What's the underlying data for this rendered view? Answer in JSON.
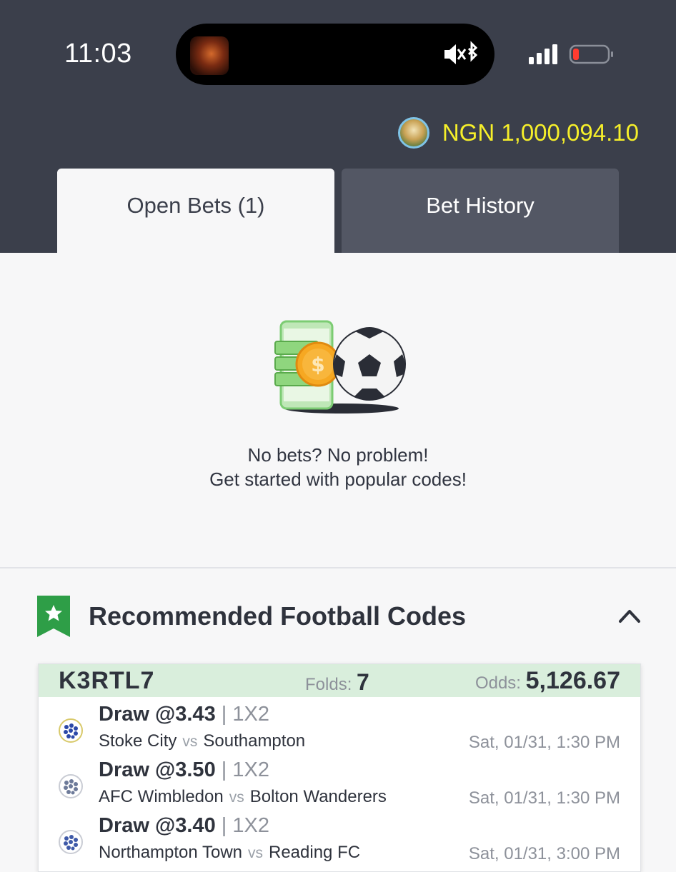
{
  "status_bar": {
    "time": "11:03"
  },
  "wallet": {
    "balance": "NGN 1,000,094.10"
  },
  "tabs": [
    {
      "label": "Open Bets (1)",
      "active": true
    },
    {
      "label": "Bet History",
      "active": false
    }
  ],
  "empty_state": {
    "line1": "No bets? No problem!",
    "line2": "Get started with popular codes!"
  },
  "recommended": {
    "title": "Recommended Football Codes",
    "card": {
      "code": "K3RTL7",
      "folds_label": "Folds:",
      "folds_value": "7",
      "odds_label": "Odds:",
      "odds_value": "5,126.67",
      "selections": [
        {
          "pick": "Draw @3.43",
          "market": "| 1X2",
          "home": "Stoke City",
          "vs": "vs",
          "away": "Southampton",
          "time": "Sat, 01/31, 1:30 PM"
        },
        {
          "pick": "Draw @3.50",
          "market": "| 1X2",
          "home": "AFC Wimbledon",
          "vs": "vs",
          "away": "Bolton Wanderers",
          "time": "Sat, 01/31, 1:30 PM"
        },
        {
          "pick": "Draw @3.40",
          "market": "| 1X2",
          "home": "Northampton Town",
          "vs": "vs",
          "away": "Reading FC",
          "time": "Sat, 01/31, 3:00 PM"
        }
      ]
    }
  },
  "colors": {
    "header_bg": "#3b3f4b",
    "balance": "#f6ef2a",
    "accent_green": "#2e9e47",
    "card_header": "#d9eedc"
  }
}
